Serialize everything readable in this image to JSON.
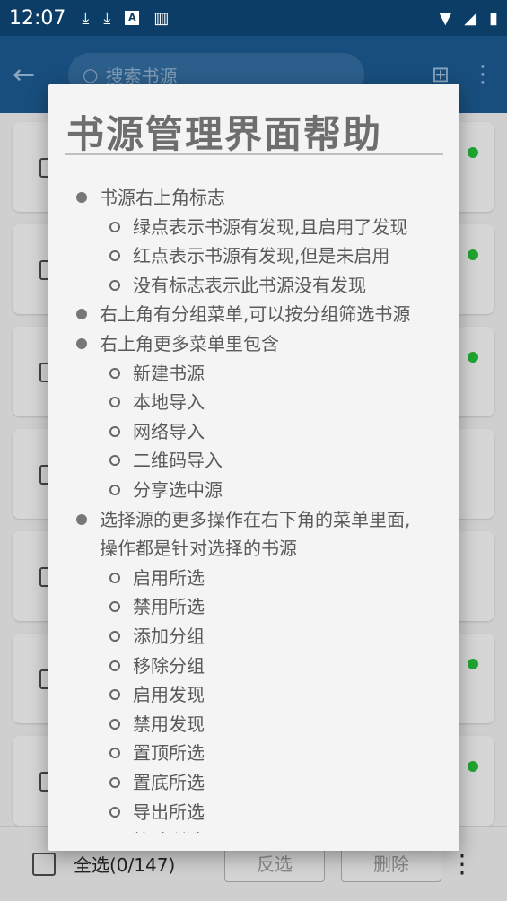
{
  "status_bar": {
    "time": "12:07",
    "notif_box_letter": "A"
  },
  "search": {
    "placeholder": "搜索书源"
  },
  "bottom_bar": {
    "select_all": "全选(0/147)",
    "invert": "反选",
    "delete": "删除"
  },
  "dialog": {
    "title": "书源管理界面帮助",
    "items": [
      {
        "level": 1,
        "text": "书源右上角标志"
      },
      {
        "level": 2,
        "text": "绿点表示书源有发现,且启用了发现"
      },
      {
        "level": 2,
        "text": "红点表示书源有发现,但是未启用"
      },
      {
        "level": 2,
        "text": "没有标志表示此书源没有发现"
      },
      {
        "level": 1,
        "text": "右上角有分组菜单,可以按分组筛选书源"
      },
      {
        "level": 1,
        "text": "右上角更多菜单里包含"
      },
      {
        "level": 2,
        "text": "新建书源"
      },
      {
        "level": 2,
        "text": "本地导入"
      },
      {
        "level": 2,
        "text": "网络导入"
      },
      {
        "level": 2,
        "text": "二维码导入"
      },
      {
        "level": 2,
        "text": "分享选中源"
      },
      {
        "level": 1,
        "text": "选择源的更多操作在右下角的菜单里面,"
      },
      {
        "level": 0,
        "text": "操作都是针对选择的书源"
      },
      {
        "level": 2,
        "text": "启用所选"
      },
      {
        "level": 2,
        "text": "禁用所选"
      },
      {
        "level": 2,
        "text": "添加分组"
      },
      {
        "level": 2,
        "text": "移除分组"
      },
      {
        "level": 2,
        "text": "启用发现"
      },
      {
        "level": 2,
        "text": "禁用发现"
      },
      {
        "level": 2,
        "text": "置顶所选"
      },
      {
        "level": 2,
        "text": "置底所选"
      },
      {
        "level": 2,
        "text": "导出所选"
      },
      {
        "level": 2,
        "text": "校验所选"
      }
    ]
  },
  "colors": {
    "accent": "#0b3d66",
    "dot_green": "#1fa531"
  }
}
